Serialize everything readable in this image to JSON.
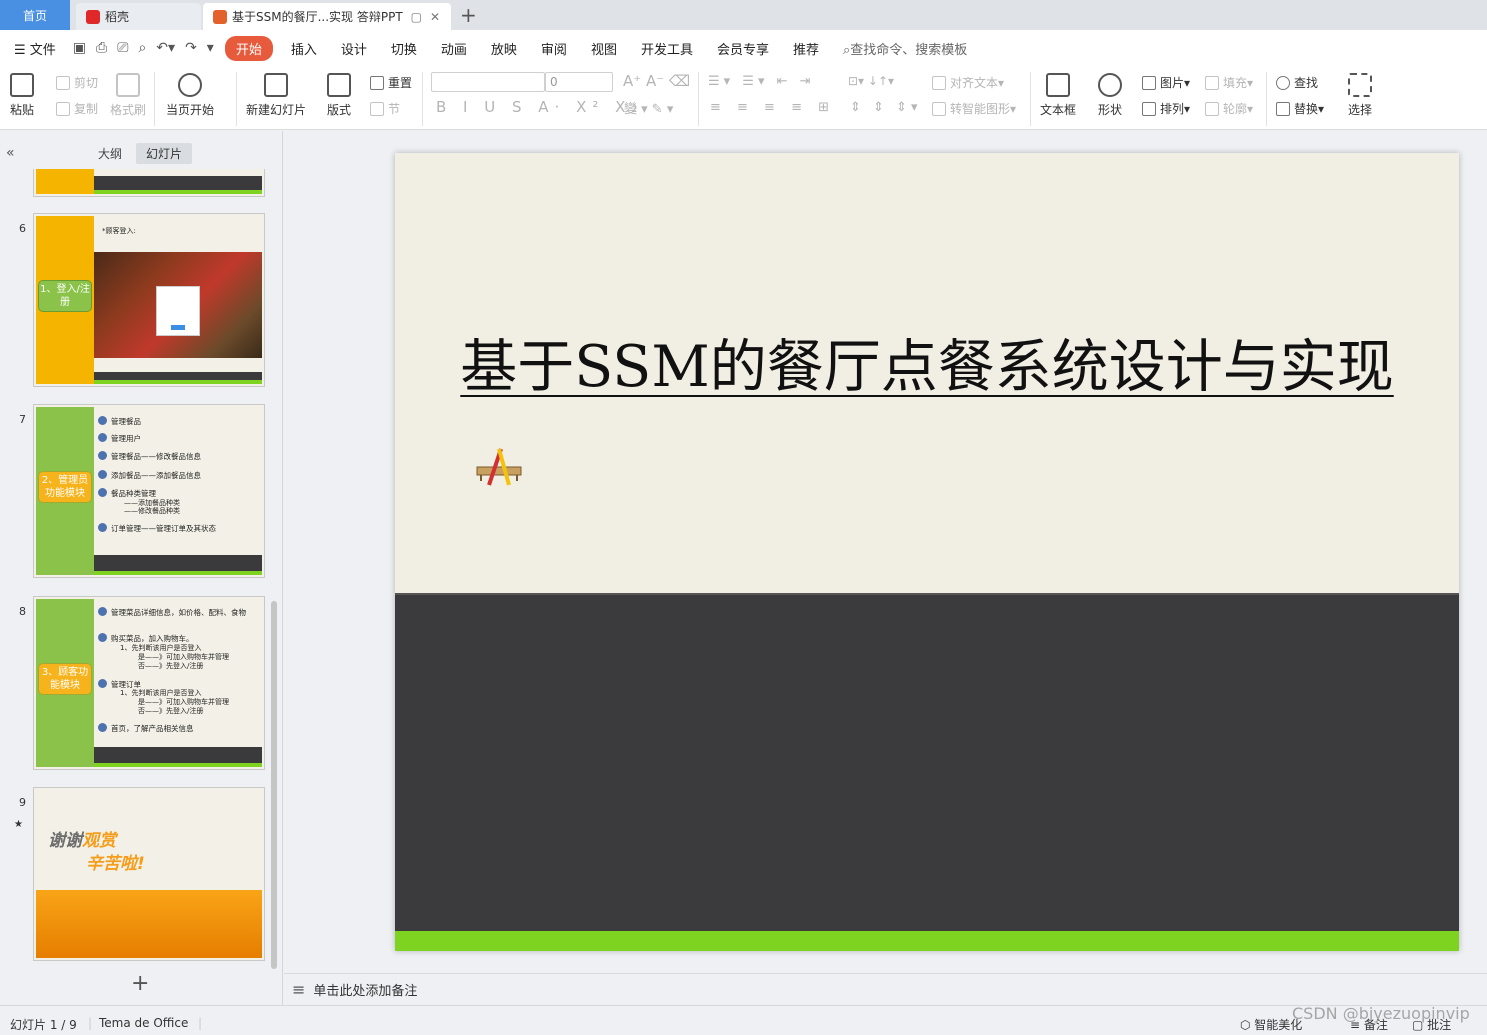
{
  "tabs": {
    "home": "首页",
    "daoke": "稻壳",
    "document": "基于SSM的餐厅...实现 答辩PPT"
  },
  "menu": {
    "file": "文件",
    "items": [
      "开始",
      "插入",
      "设计",
      "切换",
      "动画",
      "放映",
      "审阅",
      "视图",
      "开发工具",
      "会员专享",
      "推荐"
    ],
    "search": "查找命令、搜索模板"
  },
  "ribbon": {
    "paste": "粘贴",
    "cut": "剪切",
    "copy": "复制",
    "format_painter": "格式刷",
    "from_start": "当页开始",
    "new_slide": "新建幻灯片",
    "layout": "版式",
    "reset": "重置",
    "section": "节",
    "font_size": "0",
    "align_text": "对齐文本",
    "smart_shape": "转智能图形",
    "text_box": "文本框",
    "shape": "形状",
    "picture": "图片",
    "arrange": "排列",
    "fill": "填充",
    "outline": "轮廓",
    "find": "查找",
    "replace": "替换",
    "select": "选择"
  },
  "panel": {
    "outline": "大纲",
    "slides": "幻灯片"
  },
  "thumbnails": [
    {
      "number": "6",
      "label": "1、登入/注册",
      "header": "*顾客登入:"
    },
    {
      "number": "7",
      "label": "2、管理员功能模块",
      "bullets": [
        "管理餐品",
        "管理用户",
        "管理餐品——修改餐品信息",
        "添加餐品——添加餐品信息",
        "餐品种类管理",
        "订单管理——管理订单及其状态"
      ],
      "subs": [
        "——添加餐品种类",
        "——修改餐品种类"
      ]
    },
    {
      "number": "8",
      "label": "3、顾客功能模块",
      "bullets": [
        "管理菜品详细信息，如价格、配料、食物",
        "购买菜品，加入购物车。",
        "管理订单",
        "首页，了解产品相关信息"
      ],
      "subs": [
        "1、先判断该用户是否登入",
        "是——》可加入购物车并管理",
        "否——》先登入/注册",
        "1、先判断该用户是否登入",
        "是——》可加入购物车并管理",
        "否——》先登入/注册"
      ]
    },
    {
      "number": "9",
      "line1_a": "谢谢",
      "line1_b": "观赏",
      "line2": "辛苦啦!"
    }
  ],
  "slide": {
    "title": "基于SSM的餐厅点餐系统设计与实现"
  },
  "notes": {
    "placeholder": "单击此处添加备注"
  },
  "status": {
    "slide_count": "幻灯片 1 / 9",
    "theme": "Tema de Office",
    "smart_beautify": "智能美化",
    "notes": "备注",
    "comments": "批注"
  },
  "watermark": "CSDN @biyezuopinvip",
  "colors": {
    "accent": "#e85a3c",
    "home_tab": "#4a90e2",
    "slide_green": "#7ed321",
    "slide_dark": "#3b3b3e"
  }
}
